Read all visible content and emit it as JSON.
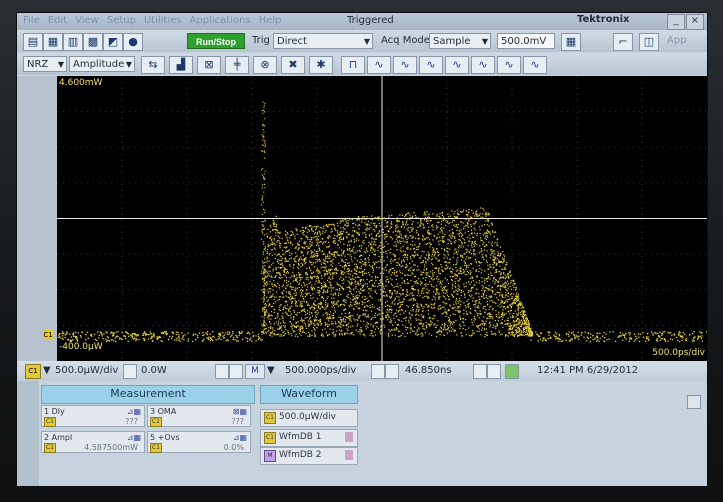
{
  "menu": {
    "items": [
      "File",
      "Edit",
      "View",
      "Setup",
      "Utilities",
      "Applications",
      "Help"
    ],
    "status": "Triggered",
    "brand": "Tektronix",
    "min": "_",
    "close": "×"
  },
  "toolbar1": {
    "run_stop": "Run/Stop",
    "trig_label": "Trig",
    "trig_value": "Direct",
    "acq_label": "Acq Mode",
    "acq_value": "Sample",
    "voltage": "500.0mV",
    "app": "App"
  },
  "toolbar2": {
    "format": "NRZ",
    "mode": "Amplitude"
  },
  "graticule": {
    "top_label": "4.600mW",
    "bottom_label": "-400.0μW",
    "timebase": "500.0ps/div",
    "channel_marker": "C1"
  },
  "bottombar": {
    "vert_scale": "500.0μW/div",
    "offset": "0.0W",
    "math": "M",
    "horiz_scale": "500.000ps/div",
    "position": "46.850ns",
    "timestamp": "12:41 PM 6/29/2012"
  },
  "panel": {
    "measurement_tab": "Measurement",
    "waveform_tab": "Waveform",
    "measurements": [
      {
        "name": "1 Dly",
        "value": "???"
      },
      {
        "name": "3 OMA",
        "value": "???"
      },
      {
        "name": "2 Ampl",
        "value": "4.587500mW"
      },
      {
        "name": "5 +Ovs",
        "value": "0.0%"
      }
    ],
    "waveforms": [
      {
        "label": "500.0μW/div"
      },
      {
        "label": "WfmDB 1"
      },
      {
        "label": "WfmDB 2"
      }
    ]
  },
  "colors": {
    "trace": "#e6cf3c",
    "grid": "#3a3a3a",
    "run_button": "#2ea02e"
  }
}
